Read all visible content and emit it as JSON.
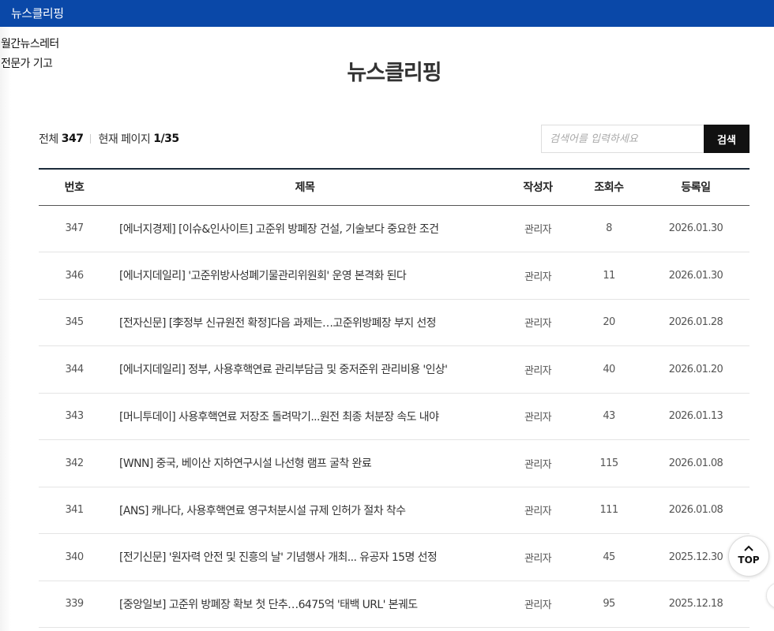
{
  "header": {
    "title": "뉴스클리핑"
  },
  "sidenav": {
    "items": [
      {
        "label": "월간뉴스레터"
      },
      {
        "label": "전문가 기고"
      }
    ]
  },
  "page": {
    "title": "뉴스클리핑"
  },
  "summary": {
    "total_label": "전체",
    "total_count": "347",
    "page_label": "현재 페이지",
    "page_value": "1/35"
  },
  "search": {
    "placeholder": "검색어를 입력하세요",
    "button_label": "검색"
  },
  "table": {
    "headers": {
      "no": "번호",
      "subject": "제목",
      "writer": "작성자",
      "views": "조회수",
      "date": "등록일"
    },
    "rows": [
      {
        "no": "347",
        "subject": "[에너지경제] [이슈&인사이트] 고준위 방폐장 건설, 기술보다 중요한 조건",
        "writer": "관리자",
        "views": "8",
        "date": "2026.01.30"
      },
      {
        "no": "346",
        "subject": "[에너지데일리] '고준위방사성폐기물관리위원회' 운영 본격화 된다",
        "writer": "관리자",
        "views": "11",
        "date": "2026.01.30"
      },
      {
        "no": "345",
        "subject": "[전자신문] [李정부 신규원전 확정]다음 과제는…고준위방폐장 부지 선정",
        "writer": "관리자",
        "views": "20",
        "date": "2026.01.28"
      },
      {
        "no": "344",
        "subject": "[에너지데일리] 정부, 사용후핵연료 관리부담금 및 중저준위 관리비용 '인상'",
        "writer": "관리자",
        "views": "40",
        "date": "2026.01.20"
      },
      {
        "no": "343",
        "subject": "[머니투데이] 사용후핵연료 저장조 돌려막기...원전 최종 처분장 속도 내야",
        "writer": "관리자",
        "views": "43",
        "date": "2026.01.13"
      },
      {
        "no": "342",
        "subject": "[WNN] 중국, 베이산 지하연구시설 나선형 램프 굴착 완료",
        "writer": "관리자",
        "views": "115",
        "date": "2026.01.08"
      },
      {
        "no": "341",
        "subject": "[ANS] 캐나다, 사용후핵연료 영구처분시설 규제 인허가 절차 착수",
        "writer": "관리자",
        "views": "111",
        "date": "2026.01.08"
      },
      {
        "no": "340",
        "subject": "[전기신문] '원자력 안전 및 진흥의 날' 기념행사 개최... 유공자 15명 선정",
        "writer": "관리자",
        "views": "45",
        "date": "2025.12.30"
      },
      {
        "no": "339",
        "subject": "[중앙일보] 고준위 방폐장 확보 첫 단추…6475억 '태백 URL' 본궤도",
        "writer": "관리자",
        "views": "95",
        "date": "2025.12.18"
      }
    ]
  },
  "top_button": {
    "icon": "chevron-up-icon",
    "label": "TOP"
  },
  "colors": {
    "header_bg": "#0a48a8",
    "search_button_bg": "#111111",
    "table_top_border": "#1c2b3a"
  }
}
